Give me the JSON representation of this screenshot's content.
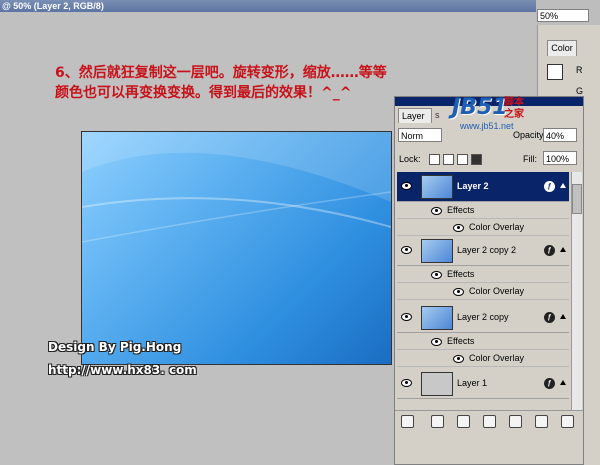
{
  "window": {
    "title": "@ 50% (Layer 2, RGB/8)",
    "zoom": "50%"
  },
  "instruction": {
    "line1": "6、然后就狂复制这一层吧。旋转变形，缩放……等等",
    "line2": "颜色也可以再变换变换。得到最后的效果！^_^"
  },
  "watermark": {
    "credit": "Design By Pig.Hong",
    "url": "http://www.hx83. com"
  },
  "color_panel": {
    "tab": "Color",
    "r": "R",
    "g": "G"
  },
  "logo": {
    "main": "JB51",
    "side_top": "脚本",
    "side_bottom": "之家",
    "url": "www.jb51.net"
  },
  "layers_panel": {
    "tab": "Layer",
    "tab2": "s",
    "blend_mode": "Norm",
    "opacity_label": "Opacity:",
    "opacity": "40%",
    "lock_label": "Lock:",
    "fill_label": "Fill:",
    "fill": "100%",
    "layers": [
      {
        "name": "Layer 2",
        "selected": true,
        "effects_label": "Effects",
        "effect": "Color Overlay"
      },
      {
        "name": "Layer 2 copy 2",
        "selected": false,
        "effects_label": "Effects",
        "effect": "Color Overlay"
      },
      {
        "name": "Layer 2 copy",
        "selected": false,
        "effects_label": "Effects",
        "effect": "Color Overlay"
      },
      {
        "name": "Layer 1",
        "selected": false
      }
    ]
  },
  "icons": {
    "eye": "eye-icon",
    "fx": "fx-icon"
  },
  "colors": {
    "accent": "#0a246a",
    "instruction": "#c8121a",
    "background": "#bdbdbd"
  }
}
